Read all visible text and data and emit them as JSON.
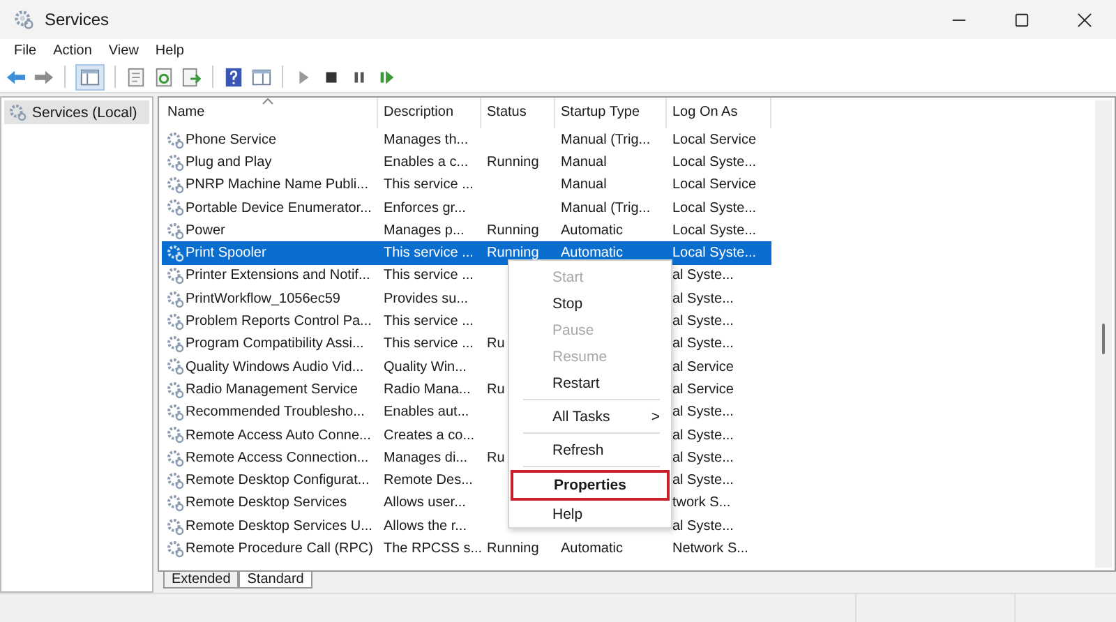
{
  "window": {
    "title": "Services"
  },
  "menu_bar": [
    "File",
    "Action",
    "View",
    "Help"
  ],
  "tree": {
    "items": [
      {
        "label": "Services (Local)",
        "selected": true
      }
    ]
  },
  "table": {
    "columns": [
      "Name",
      "Description",
      "Status",
      "Startup Type",
      "Log On As"
    ],
    "rows": [
      {
        "name": "Phone Service",
        "description": "Manages th...",
        "startup_type": "Manual (Trig...",
        "log_on_as": "Local Service",
        "selected": false
      },
      {
        "name": "Plug and Play",
        "description": "Enables a c...",
        "status": "Running",
        "startup_type": "Manual",
        "log_on_as": "Local Syste...",
        "selected": false
      },
      {
        "name": "PNRP Machine Name Publi...",
        "description": "This service ...",
        "startup_type": "Manual",
        "log_on_as": "Local Service",
        "selected": false
      },
      {
        "name": "Portable Device Enumerator...",
        "description": "Enforces gr...",
        "startup_type": "Manual (Trig...",
        "log_on_as": "Local Syste...",
        "selected": false
      },
      {
        "name": "Power",
        "description": "Manages p...",
        "status": "Running",
        "startup_type": "Automatic",
        "log_on_as": "Local Syste...",
        "selected": false
      },
      {
        "name": "Print Spooler",
        "description": "This service ...",
        "status": "Running",
        "startup_type": "Automatic",
        "log_on_as": "Local Syste...",
        "selected": true
      },
      {
        "name": "Printer Extensions and Notif...",
        "description": "This service ...",
        "log_on_as": "al Syste...",
        "selected": false
      },
      {
        "name": "PrintWorkflow_1056ec59",
        "description": "Provides su...",
        "log_on_as": "al Syste...",
        "selected": false
      },
      {
        "name": "Problem Reports Control Pa...",
        "description": "This service ...",
        "log_on_as": "al Syste...",
        "selected": false
      },
      {
        "name": "Program Compatibility Assi...",
        "description": "This service ...",
        "status": "Ru",
        "log_on_as": "al Syste...",
        "selected": false
      },
      {
        "name": "Quality Windows Audio Vid...",
        "description": "Quality Win...",
        "log_on_as": "al Service",
        "selected": false
      },
      {
        "name": "Radio Management Service",
        "description": "Radio Mana...",
        "status": "Ru",
        "log_on_as": "al Service",
        "selected": false
      },
      {
        "name": "Recommended Troublesho...",
        "description": "Enables aut...",
        "log_on_as": "al Syste...",
        "selected": false
      },
      {
        "name": "Remote Access Auto Conne...",
        "description": "Creates a co...",
        "log_on_as": "al Syste...",
        "selected": false
      },
      {
        "name": "Remote Access Connection...",
        "description": "Manages di...",
        "status": "Ru",
        "log_on_as": "al Syste...",
        "selected": false
      },
      {
        "name": "Remote Desktop Configurat...",
        "description": "Remote Des...",
        "log_on_as": "al Syste...",
        "selected": false
      },
      {
        "name": "Remote Desktop Services",
        "description": "Allows user...",
        "log_on_as": "twork S...",
        "selected": false
      },
      {
        "name": "Remote Desktop Services U...",
        "description": "Allows the r...",
        "log_on_as": "al Syste...",
        "selected": false
      },
      {
        "name": "Remote Procedure Call (RPC)",
        "description": "The RPCSS s...",
        "status": "Running",
        "startup_type": "Automatic",
        "log_on_as": "Network S...",
        "selected": false
      }
    ]
  },
  "view_tabs": [
    {
      "label": "Extended",
      "selected": false
    },
    {
      "label": "Standard",
      "selected": true
    }
  ],
  "context_menu": {
    "items": [
      {
        "kind": "item",
        "label": "Start",
        "disabled": true
      },
      {
        "kind": "item",
        "label": "Stop",
        "disabled": false
      },
      {
        "kind": "item",
        "label": "Pause",
        "disabled": true
      },
      {
        "kind": "item",
        "label": "Resume",
        "disabled": true
      },
      {
        "kind": "item",
        "label": "Restart",
        "disabled": false
      },
      {
        "kind": "separator"
      },
      {
        "kind": "submenu",
        "label": "All Tasks",
        "arrow": ">",
        "disabled": false
      },
      {
        "kind": "separator"
      },
      {
        "kind": "item",
        "label": "Refresh",
        "disabled": false
      },
      {
        "kind": "separator"
      },
      {
        "kind": "item",
        "label": "Properties",
        "disabled": false,
        "default": true,
        "outlined": true
      },
      {
        "kind": "item",
        "label": "Help",
        "disabled": false
      }
    ]
  }
}
